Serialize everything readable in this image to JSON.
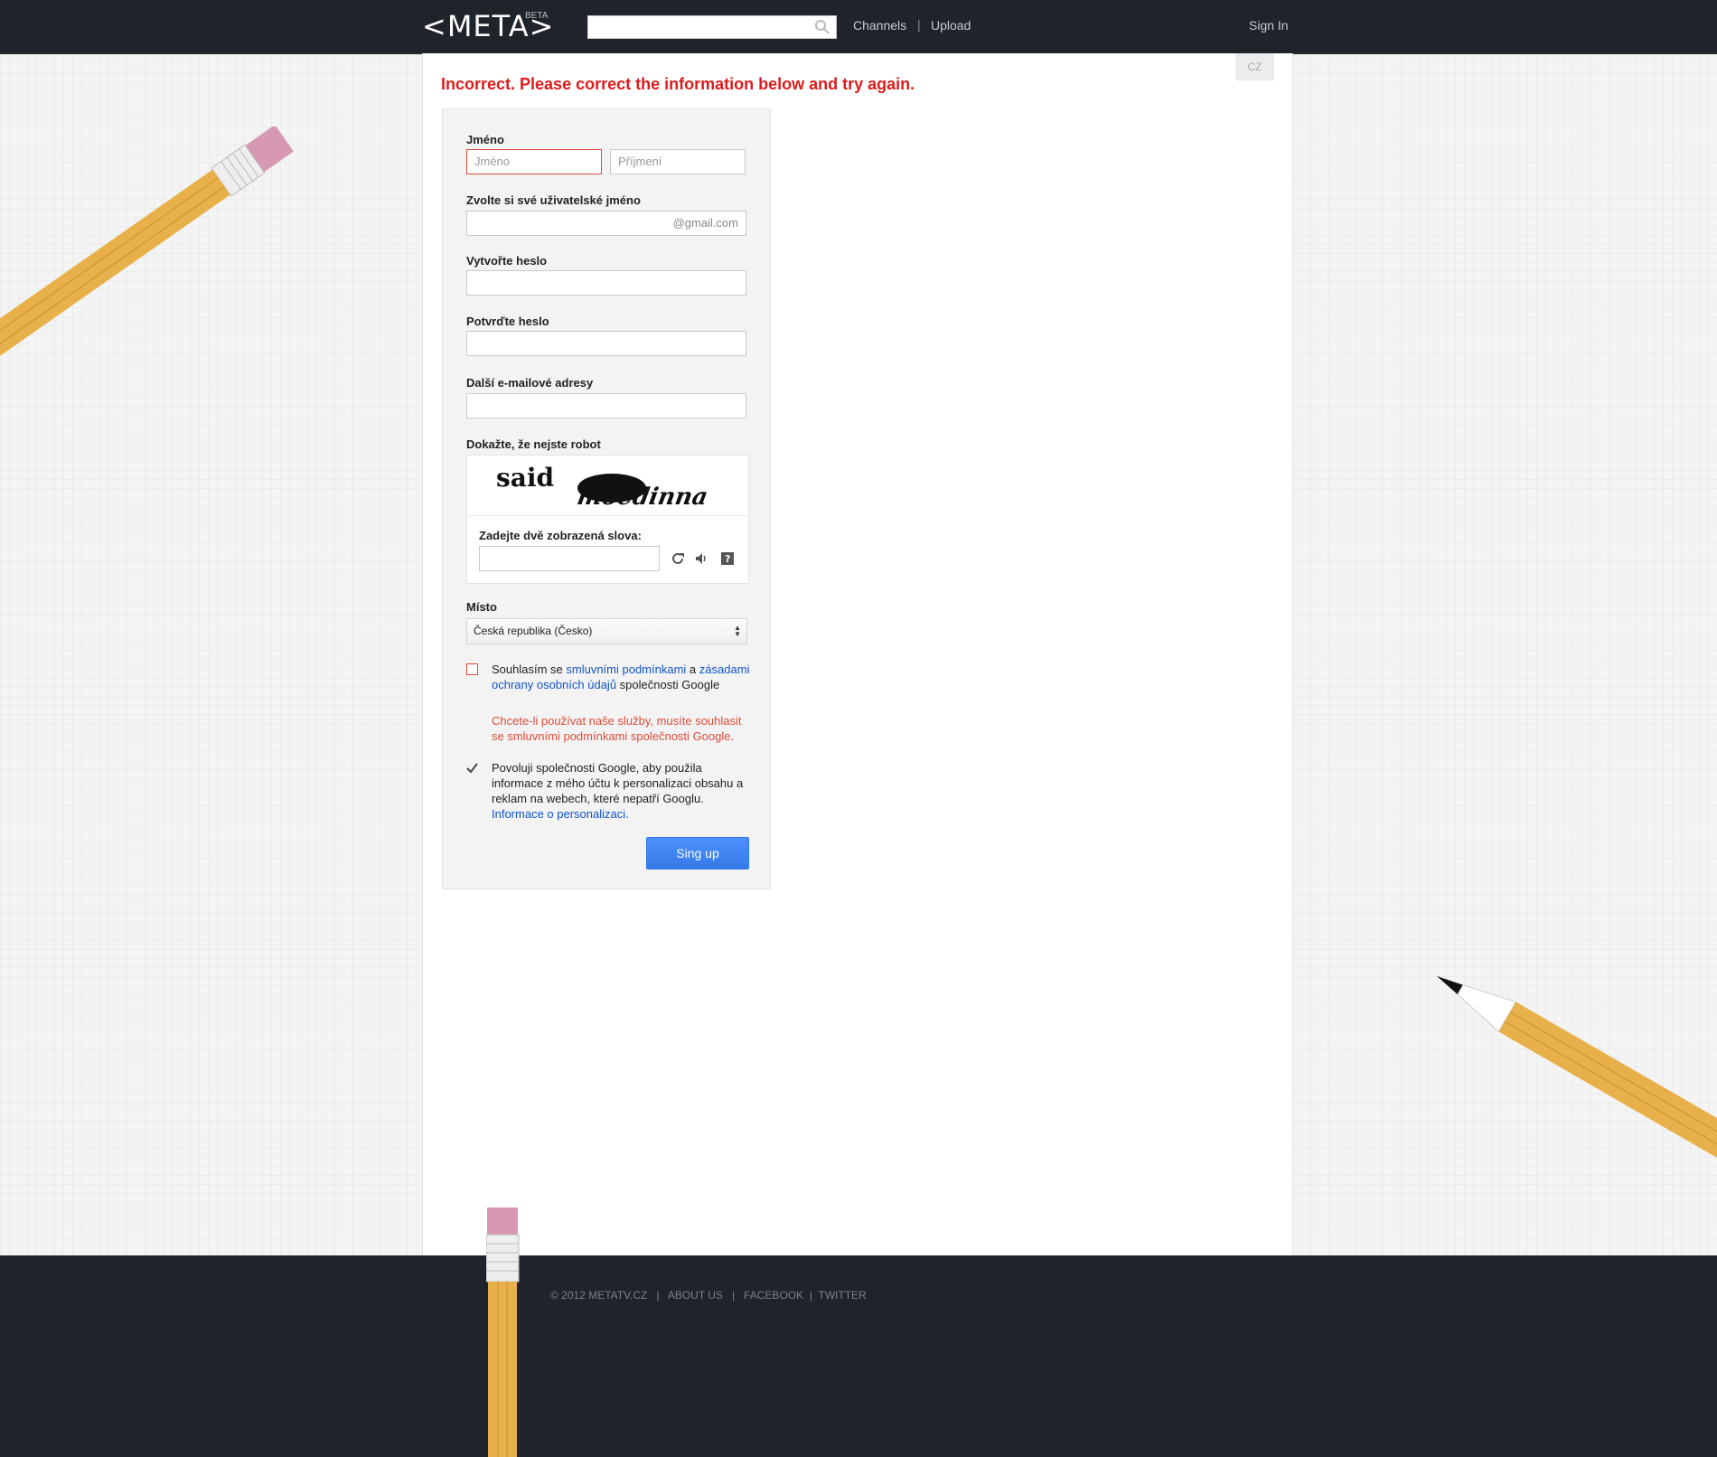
{
  "header": {
    "logo": "<META>",
    "beta": "BETA",
    "search": {
      "placeholder": ""
    },
    "nav": {
      "channels": "Channels",
      "separator": "|",
      "upload": "Upload"
    },
    "signin": "Sign In"
  },
  "lang": "CZ",
  "error_message": "Incorrect. Please correct the information below and try again.",
  "form": {
    "name": {
      "label": "Jméno",
      "first_placeholder": "Jméno",
      "last_placeholder": "Příjmení"
    },
    "username": {
      "label": "Zvolte si své uživatelské jméno",
      "suffix": "@gmail.com",
      "value": ""
    },
    "password": {
      "label": "Vytvořte heslo"
    },
    "confirm_password": {
      "label": "Potvrďte heslo"
    },
    "other_email": {
      "label": "Další e-mailové adresy"
    },
    "captcha": {
      "label": "Dokažte, že nejste robot",
      "word1": "said",
      "word2": "moedinna",
      "prompt": "Zadejte dvě zobrazená slova:",
      "icons": [
        "refresh-icon",
        "audio-icon",
        "help-icon"
      ]
    },
    "location": {
      "label": "Místo",
      "selected": "Česká republika (Česko)"
    },
    "terms": {
      "checked": false,
      "text_prefix": "Souhlasím se ",
      "link1": "smluvními podmínkami",
      "text_mid": " a",
      "link2": "zásadami ochrany osobních údajů",
      "text_suffix": " společnosti Google",
      "error": "Chcete-li používat naše služby, musíte souhlasit se smluvními podmínkami společnosti Google."
    },
    "personalization": {
      "checked": true,
      "text": "Povoluji společnosti Google, aby použila informace z mého účtu k personalizaci obsahu a reklam na webech, které nepatří Googlu.",
      "link": "Informace o personalizaci",
      "link_suffix": "."
    },
    "submit": "Sing up"
  },
  "footer": {
    "copyright": "© 2012 METATV.CZ",
    "about": "ABOUT US",
    "facebook": "FACEBOOK",
    "twitter": "TWITTER",
    "sep": "|"
  },
  "colors": {
    "topbar": "#1f232a",
    "error": "#dd1b1b",
    "link": "#1155cc",
    "button": "#4d90fe",
    "pencil_body": "#e8b04a",
    "eraser": "#d799b2"
  }
}
